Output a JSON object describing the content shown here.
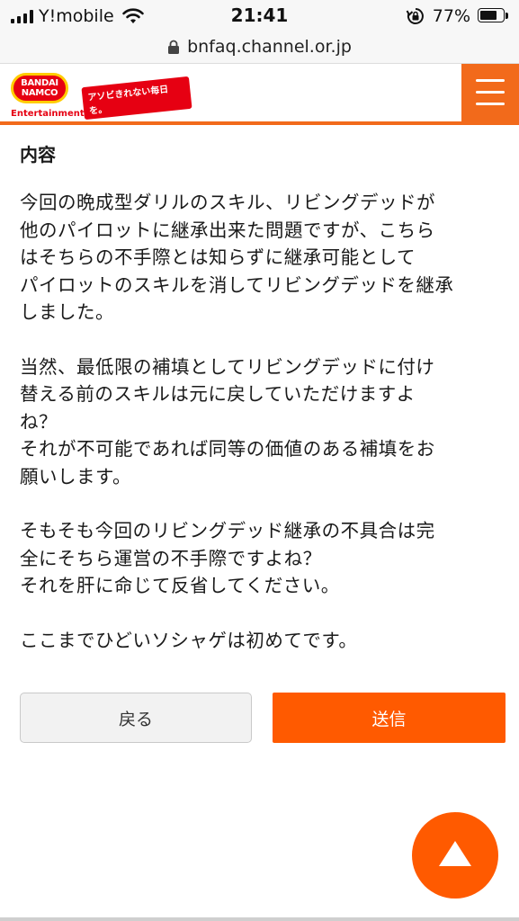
{
  "status_bar": {
    "carrier": "Y!mobile",
    "time": "21:41",
    "battery_percent": "77%",
    "battery_level": 0.77
  },
  "url_bar": {
    "url": "bnfaq.channel.or.jp"
  },
  "header": {
    "logo_line1": "BANDAI",
    "logo_line2": "NAMCO",
    "logo_sub": "Entertainment",
    "tagline": "アソビきれない毎日を。",
    "accent_color": "#f26a1b"
  },
  "content": {
    "section_title": "内容",
    "paragraphs": [
      {
        "lines": [
          "今回の晩成型ダリルのスキル、リビングデッドが",
          "他のパイロットに継承出来た問題ですが、こちら",
          "はそちらの不手際とは知らずに継承可能として",
          "パイロットのスキルを消してリビングデッドを継承",
          "しました。"
        ]
      },
      {
        "lines": [
          "当然、最低限の補填としてリビングデッドに付け",
          "替える前のスキルは元に戻していただけますよ",
          "ね？",
          "それが不可能であれば同等の価値のある補填をお",
          "願いします。"
        ]
      },
      {
        "lines": [
          "そもそも今回のリビングデッド継承の不具合は完",
          "全にそちら運営の不手際ですよね？",
          "それを肝に命じて反省してください。"
        ]
      },
      {
        "lines": [
          "ここまでひどいソシャゲは初めてです。"
        ]
      }
    ]
  },
  "actions": {
    "back_label": "戻る",
    "send_label": "送信",
    "send_color": "#ff5a00"
  },
  "scroll_top": {
    "icon": "triangle-up-icon"
  }
}
